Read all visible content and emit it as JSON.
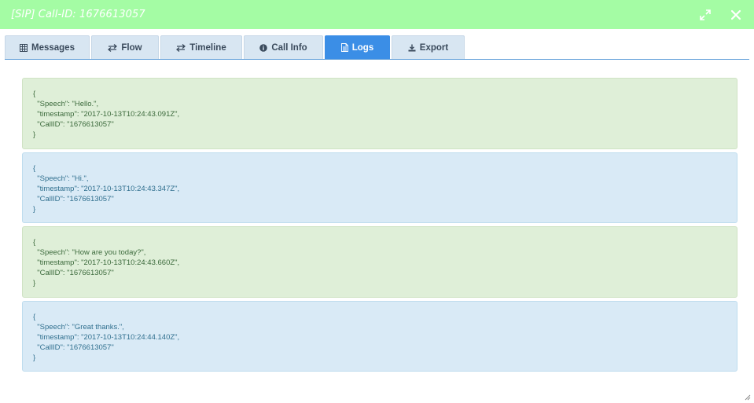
{
  "window": {
    "title": "[SIP] Call-ID: 1676613057",
    "background_color": "#a4fca4",
    "expand_icon": "expand-arrows-icon",
    "close_icon": "close-icon"
  },
  "tabs": [
    {
      "label": "Messages",
      "icon": "grid-icon",
      "active": false
    },
    {
      "label": "Flow",
      "icon": "swap-arrows-icon",
      "active": false
    },
    {
      "label": "Timeline",
      "icon": "swap-arrows-icon",
      "active": false
    },
    {
      "label": "Call Info",
      "icon": "info-circle-icon",
      "active": false
    },
    {
      "label": "Logs",
      "icon": "document-icon",
      "active": true
    },
    {
      "label": "Export",
      "icon": "download-icon",
      "active": false
    }
  ],
  "colors": {
    "active_tab": "#3b8ee6",
    "inactive_tab": "#d8e6f2",
    "log_green": "#dfefd8",
    "log_blue": "#d9eaf6"
  },
  "logs": [
    {
      "style": "green",
      "lines": [
        "{",
        "  \"Speech\": \"Hello.\",",
        "  \"timestamp\": \"2017-10-13T10:24:43.091Z\",",
        "  \"CallID\": \"1676613057\"",
        "}"
      ]
    },
    {
      "style": "blue",
      "lines": [
        "{",
        "  \"Speech\": \"Hi.\",",
        "  \"timestamp\": \"2017-10-13T10:24:43.347Z\",",
        "  \"CallID\": \"1676613057\"",
        "}"
      ]
    },
    {
      "style": "green",
      "lines": [
        "{",
        "  \"Speech\": \"How are you today?\",",
        "  \"timestamp\": \"2017-10-13T10:24:43.660Z\",",
        "  \"CallID\": \"1676613057\"",
        "}"
      ]
    },
    {
      "style": "blue",
      "lines": [
        "{",
        "  \"Speech\": \"Great thanks.\",",
        "  \"timestamp\": \"2017-10-13T10:24:44.140Z\",",
        "  \"CallID\": \"1676613057\"",
        "}"
      ]
    }
  ]
}
